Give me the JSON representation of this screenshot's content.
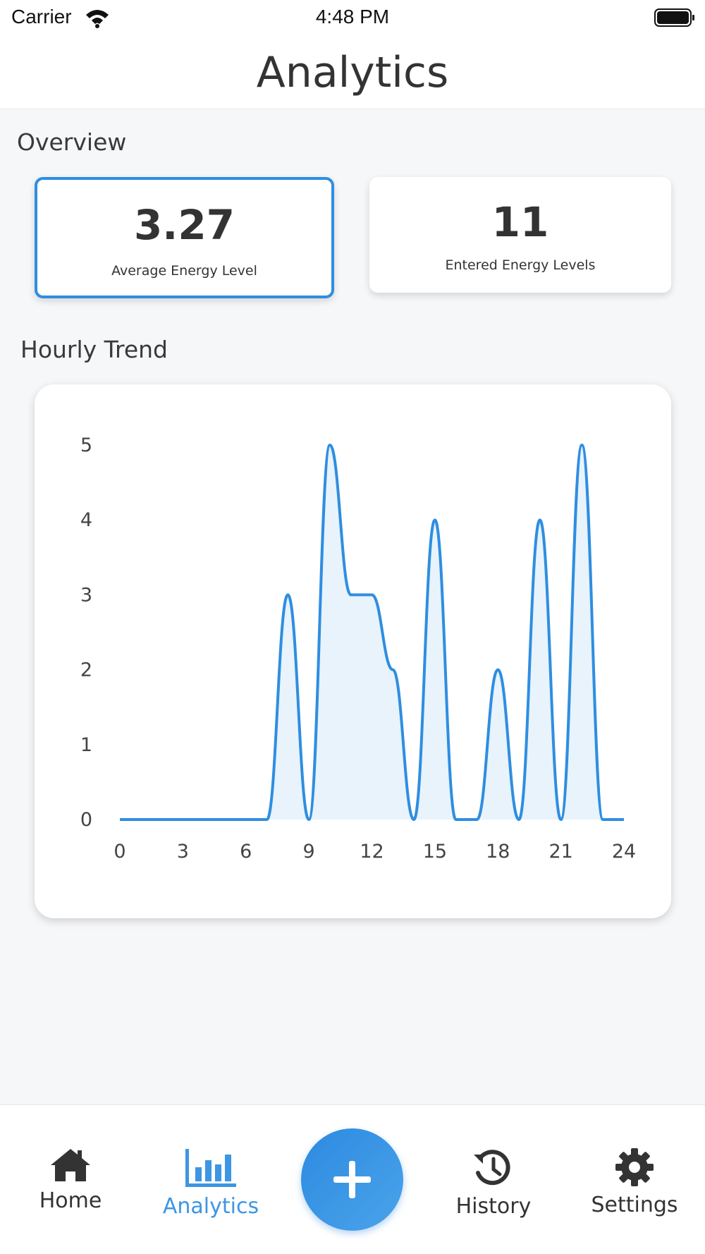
{
  "status_bar": {
    "carrier": "Carrier",
    "time": "4:48 PM"
  },
  "header": {
    "title": "Analytics"
  },
  "overview": {
    "title": "Overview",
    "average": {
      "value": "3.27",
      "label": "Average Energy Level"
    },
    "count": {
      "value": "11",
      "label": "Entered Energy Levels"
    }
  },
  "trend": {
    "title": "Hourly Trend"
  },
  "chart_data": {
    "type": "area",
    "title": "",
    "xlabel": "",
    "ylabel": "",
    "x": [
      0,
      1,
      2,
      3,
      4,
      5,
      6,
      7,
      8,
      9,
      10,
      11,
      12,
      13,
      14,
      15,
      16,
      17,
      18,
      19,
      20,
      21,
      22,
      23,
      24
    ],
    "values": [
      0,
      0,
      0,
      0,
      0,
      0,
      0,
      0,
      3,
      0,
      5,
      3,
      3,
      2,
      0,
      4,
      0,
      0,
      2,
      0,
      4,
      0,
      5,
      0,
      0
    ],
    "xlim": [
      0,
      24
    ],
    "ylim": [
      0,
      5
    ],
    "x_ticks": [
      "0",
      "3",
      "6",
      "9",
      "12",
      "15",
      "18",
      "21",
      "24"
    ],
    "y_ticks": [
      "0",
      "1",
      "2",
      "3",
      "4",
      "5"
    ],
    "grid": false,
    "line_color": "#2f8ee0",
    "fill_color": "#e8f3fc"
  },
  "tab_bar": {
    "tabs": [
      {
        "label": "Home",
        "icon": "home-icon"
      },
      {
        "label": "Analytics",
        "icon": "bar-chart-icon",
        "active": true
      },
      {
        "label": "History",
        "icon": "history-icon"
      },
      {
        "label": "Settings",
        "icon": "gear-icon"
      }
    ],
    "fab_icon": "plus-icon"
  },
  "colors": {
    "accent": "#2f8ee0",
    "active_tab": "#3d96e3",
    "background": "#f6f7f9"
  }
}
